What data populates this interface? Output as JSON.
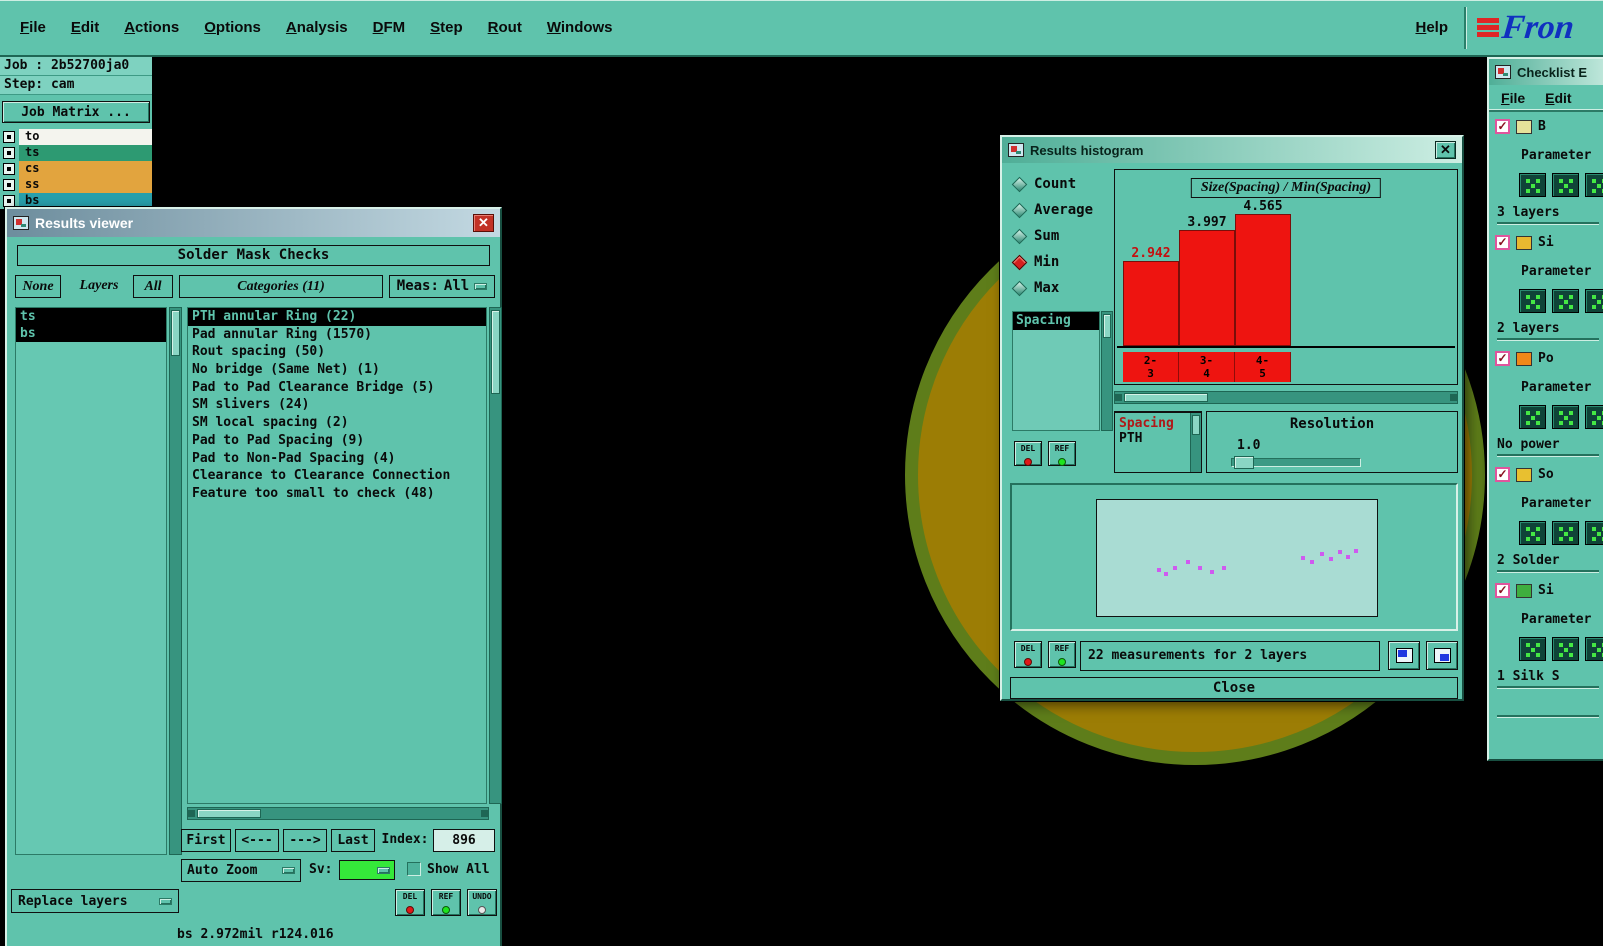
{
  "menubar": {
    "items": [
      {
        "label": "File"
      },
      {
        "label": "Edit"
      },
      {
        "label": "Actions"
      },
      {
        "label": "Options"
      },
      {
        "label": "Analysis"
      },
      {
        "label": "DFM"
      },
      {
        "label": "Step"
      },
      {
        "label": "Rout"
      },
      {
        "label": "Windows"
      }
    ],
    "help_label": "Help",
    "logo_text": "Fron",
    "logo_bar_color": "#e02626",
    "logo_text_color": "#1030c0"
  },
  "job_panel": {
    "job_label": "Job : 2b52700ja0",
    "step_label": "Step: cam",
    "job_matrix_label": "Job Matrix ...",
    "layers": [
      {
        "name": "to",
        "color": "#f4f4ee"
      },
      {
        "name": "ts",
        "color": "#2d9a72"
      },
      {
        "name": "cs",
        "color": "#e2a43e"
      },
      {
        "name": "ss",
        "color": "#e2a43e"
      },
      {
        "name": "bs",
        "color": "#28a0ac"
      }
    ]
  },
  "results_viewer": {
    "title": "Results viewer",
    "header": "Solder Mask Checks",
    "filter_none": "None",
    "filter_layers": "Layers",
    "filter_all": "All",
    "categories_label": "Categories (11)",
    "meas_label": "Meas:",
    "meas_value": "All",
    "layer_items": [
      {
        "name": "ts",
        "selected": true
      },
      {
        "name": "bs",
        "selected": true
      }
    ],
    "categories": [
      {
        "label": "PTH annular Ring (22)",
        "selected": true
      },
      {
        "label": "Pad annular Ring (1570)",
        "selected": false
      },
      {
        "label": "Rout spacing (50)",
        "selected": false
      },
      {
        "label": "No bridge (Same Net) (1)",
        "selected": false
      },
      {
        "label": "Pad to Pad Clearance Bridge (5)",
        "selected": false
      },
      {
        "label": "SM slivers (24)",
        "selected": false
      },
      {
        "label": "SM local spacing (2)",
        "selected": false
      },
      {
        "label": "Pad to Pad Spacing (9)",
        "selected": false
      },
      {
        "label": "Pad to Non-Pad Spacing (4)",
        "selected": false
      },
      {
        "label": "Clearance to Clearance Connection",
        "selected": false
      },
      {
        "label": "Feature too small to check (48)",
        "selected": false
      }
    ],
    "nav": {
      "first": "First",
      "prev": "<---",
      "next": "--->",
      "last": "Last",
      "index_label": "Index:",
      "index_value": "896"
    },
    "auto_zoom_label": "Auto Zoom",
    "sv_label": "Sv:",
    "sv_color": "#35e83a",
    "show_all_label": "Show All",
    "del_label": "DEL",
    "ref_label": "REF",
    "undo_label": "UNDO",
    "replace_layers_label": "Replace layers",
    "status_text": "bs 2.972mil  r124.016"
  },
  "histogram": {
    "title": "Results histogram",
    "stats": [
      {
        "label": "Count",
        "selected": false
      },
      {
        "label": "Average",
        "selected": false
      },
      {
        "label": "Sum",
        "selected": false
      },
      {
        "label": "Min",
        "selected": true
      },
      {
        "label": "Max",
        "selected": false
      }
    ],
    "measure_list": [
      {
        "label": "Spacing",
        "selected": true
      }
    ],
    "chart_title": "Size(Spacing) / Min(Spacing)",
    "chart_data": {
      "type": "bar",
      "title": "Size(Spacing) / Min(Spacing)",
      "categories": [
        "2-3",
        "3-4",
        "4-5"
      ],
      "values": [
        2.942,
        3.997,
        4.565
      ],
      "value_labels": [
        "2.942",
        "3.997",
        "4.565"
      ],
      "highlight_index": 0,
      "bar_color": "#ee1410",
      "ylim": [
        0,
        5
      ]
    },
    "sub_list_line1": "Spacing",
    "sub_list_line2": "PTH",
    "resolution_label": "Resolution",
    "resolution_value": "1.0",
    "del_label": "DEL",
    "ref_label": "REF",
    "measurements_text": "22 measurements for 2 layers",
    "close_label": "Close",
    "preview_dots": [
      [
        60,
        68
      ],
      [
        67,
        72
      ],
      [
        76,
        66
      ],
      [
        89,
        60
      ],
      [
        101,
        66
      ],
      [
        113,
        70
      ],
      [
        125,
        66
      ],
      [
        204,
        56
      ],
      [
        213,
        60
      ],
      [
        223,
        52
      ],
      [
        232,
        57
      ],
      [
        241,
        50
      ],
      [
        249,
        55
      ],
      [
        257,
        49
      ]
    ]
  },
  "checklist": {
    "title": "Checklist E",
    "menu": [
      {
        "label": "File"
      },
      {
        "label": "Edit"
      }
    ],
    "rows": [
      {
        "type": "check",
        "label": "B",
        "icon_color": "#e6e29a"
      },
      {
        "type": "param",
        "label": "Parameter"
      },
      {
        "type": "icons"
      },
      {
        "type": "field",
        "label": "3 layers"
      },
      {
        "type": "check",
        "label": "Si",
        "icon_color": "#e8b830"
      },
      {
        "type": "param",
        "label": "Parameter"
      },
      {
        "type": "icons"
      },
      {
        "type": "field",
        "label": "2 layers"
      },
      {
        "type": "check",
        "label": "Po",
        "icon_color": "#f08818"
      },
      {
        "type": "param",
        "label": "Parameter"
      },
      {
        "type": "icons"
      },
      {
        "type": "field",
        "label": "No power"
      },
      {
        "type": "check",
        "label": "So",
        "icon_color": "#e8c030"
      },
      {
        "type": "param",
        "label": "Parameter"
      },
      {
        "type": "icons"
      },
      {
        "type": "field",
        "label": "2 Solder"
      },
      {
        "type": "check",
        "label": "Si",
        "icon_color": "#3fae3f"
      },
      {
        "type": "param",
        "label": "Parameter"
      },
      {
        "type": "icons"
      },
      {
        "type": "field",
        "label": "1 Silk S"
      },
      {
        "type": "field",
        "label": ""
      }
    ]
  }
}
